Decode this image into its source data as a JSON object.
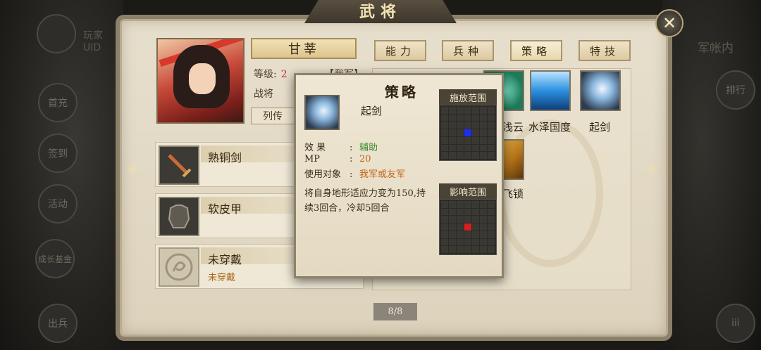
{
  "window": {
    "title": "武将",
    "close_icon": "close-icon"
  },
  "background": {
    "left_top_label": "UID",
    "left_partial_name": "玩家",
    "left_buttons": [
      "首充",
      "签到",
      "活动",
      "成长基金",
      "出兵"
    ],
    "right_label": "军帐内",
    "right_buttons": [
      "排行"
    ]
  },
  "general": {
    "name": "甘莘",
    "level_label": "等级:",
    "level_value": "2",
    "faction": "【我军】",
    "role": "战将",
    "biography_button": "列传"
  },
  "tabs": [
    {
      "label": "能力",
      "active": false
    },
    {
      "label": "兵种",
      "active": false
    },
    {
      "label": "策略",
      "active": true
    },
    {
      "label": "特技",
      "active": false
    }
  ],
  "equipment": [
    {
      "name": "熟铜剑",
      "sub": "",
      "icon": "sword-icon"
    },
    {
      "name": "软皮甲",
      "sub": "",
      "icon": "armor-icon"
    },
    {
      "name": "未穿戴",
      "sub": "未穿戴",
      "icon": "dragon-emblem-icon"
    }
  ],
  "skills_visible": [
    {
      "label": "浅云",
      "icon": "cloud-skill-icon"
    },
    {
      "label": "水泽国度",
      "icon": "wave-skill-icon"
    },
    {
      "label": "起剑",
      "icon": "sword-skill-icon"
    },
    {
      "label": "飞锁",
      "icon": "chain-skill-icon"
    }
  ],
  "pagination": "8/8",
  "popup": {
    "title": "策略",
    "skill_name": "起剑",
    "stats": [
      {
        "key": "效    果",
        "colon": ":",
        "value": "辅助",
        "color": "green"
      },
      {
        "key": "MP",
        "colon": ":",
        "value": "20",
        "color": "orange"
      },
      {
        "key": "使用对象",
        "colon": ":",
        "value": "我军或友军",
        "color": "orange"
      }
    ],
    "description": "将自身地形适应力变为150,持续3回合，冷却5回合",
    "cast_range_label": "施放范围",
    "effect_range_label": "影响范围"
  }
}
